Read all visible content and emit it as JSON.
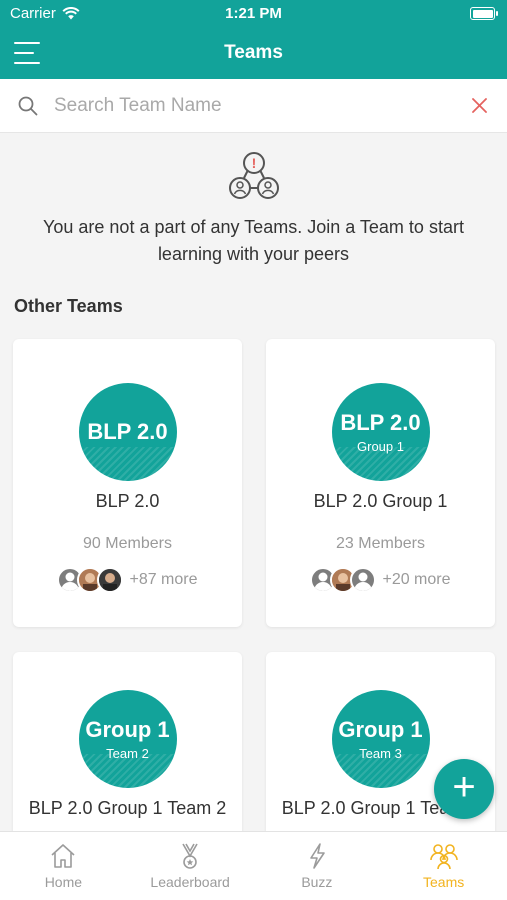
{
  "status_bar": {
    "carrier": "Carrier",
    "time": "1:21 PM"
  },
  "nav": {
    "title": "Teams"
  },
  "search": {
    "placeholder": "Search Team Name",
    "value": ""
  },
  "notice": {
    "message": "You are not a part of any Teams. Join a Team to start learning with your peers"
  },
  "other_teams": {
    "title": "Other Teams",
    "cards": [
      {
        "logo_big": "BLP 2.0",
        "logo_small": "",
        "name": "BLP 2.0",
        "members": "90 Members",
        "more": "+87 more"
      },
      {
        "logo_big": "BLP 2.0",
        "logo_small": "Group 1",
        "name": "BLP 2.0 Group 1",
        "members": "23 Members",
        "more": "+20 more"
      },
      {
        "logo_big": "Group 1",
        "logo_small": "Team 2",
        "name": "BLP 2.0 Group 1 Team 2"
      },
      {
        "logo_big": "Group 1",
        "logo_small": "Team 3",
        "name": "BLP 2.0 Group 1 Team 3"
      }
    ]
  },
  "fab": {
    "label": "+"
  },
  "tabs": [
    {
      "label": "Home",
      "icon": "home-icon"
    },
    {
      "label": "Leaderboard",
      "icon": "medal-icon"
    },
    {
      "label": "Buzz",
      "icon": "lightning-icon"
    },
    {
      "label": "Teams",
      "icon": "teams-icon",
      "active": true
    }
  ],
  "colors": {
    "brand": "#12a39a",
    "active_tab": "#f2b31f",
    "clear_icon": "#e5635f"
  }
}
